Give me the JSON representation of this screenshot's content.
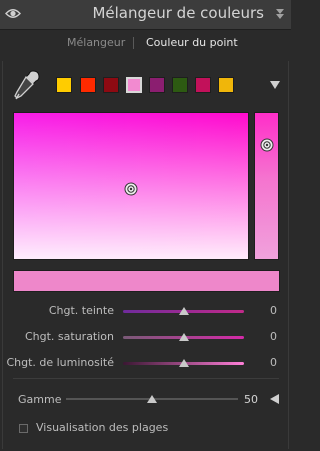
{
  "panel": {
    "title": "Mélangeur de couleurs",
    "tabs": [
      {
        "label": "Mélangeur",
        "active": false
      },
      {
        "label": "Couleur du point",
        "active": true
      }
    ]
  },
  "swatches": [
    {
      "color": "#ffcc00",
      "selected": false
    },
    {
      "color": "#ff2a00",
      "selected": false
    },
    {
      "color": "#8e0a12",
      "selected": false
    },
    {
      "color": "#f28ad0",
      "selected": true
    },
    {
      "color": "#8b1e70",
      "selected": false
    },
    {
      "color": "#2d5a12",
      "selected": false
    },
    {
      "color": "#c2115a",
      "selected": false
    },
    {
      "color": "#f0b60a",
      "selected": false
    }
  ],
  "picker": {
    "preview_color": "#ee87ca"
  },
  "sliders": [
    {
      "label": "Chgt. teinte",
      "value": "0",
      "track": "linear-gradient(to right,#6f2b9c,#c22a8a)"
    },
    {
      "label": "Chgt. saturation",
      "value": "0",
      "track": "linear-gradient(to right,#7a5a77,#d42aa8)"
    },
    {
      "label": "Chgt. de luminosité",
      "value": "0",
      "track": "linear-gradient(to right,#3b1733,#ff7fd8)"
    }
  ],
  "gamma": {
    "label": "Gamme",
    "value": "50"
  },
  "checkbox": {
    "label": "Visualisation des plages",
    "checked": false
  }
}
